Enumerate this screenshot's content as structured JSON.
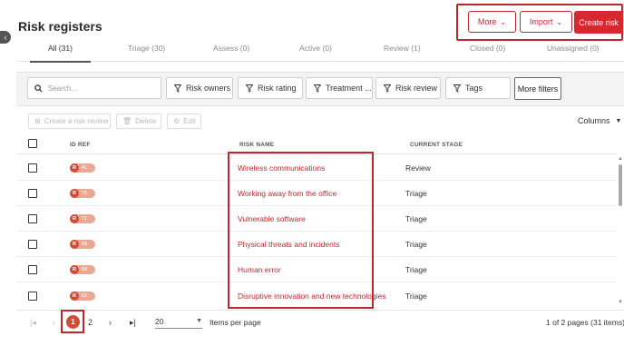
{
  "page": {
    "title": "Risk registers",
    "header_buttons": {
      "more": "More",
      "import": "Import",
      "create": "Create risk"
    },
    "tabs": [
      {
        "label": "All (31)",
        "active": true
      },
      {
        "label": "Triage (30)",
        "active": false
      },
      {
        "label": "Assess (0)",
        "active": false
      },
      {
        "label": "Active (0)",
        "active": false
      },
      {
        "label": "Review (1)",
        "active": false
      },
      {
        "label": "Closed (0)",
        "active": false
      },
      {
        "label": "Unassigned (0)",
        "active": false
      }
    ],
    "search": {
      "placeholder": "Search..."
    },
    "filters": [
      "Risk owners",
      "Risk rating",
      "Treatment ...",
      "Risk review",
      "Tags"
    ],
    "more_filters": "More filters",
    "actions": {
      "create_review": "Create a risk review",
      "delete": "Delete",
      "edit": "Edit",
      "columns": "Columns"
    },
    "table": {
      "headers": {
        "id_ref": "ID REF",
        "risk_name": "RISK NAME",
        "current_stage": "CURRENT STAGE"
      },
      "rows": [
        {
          "badge": "R",
          "id": "41",
          "name": "Wireless communications",
          "stage": "Review"
        },
        {
          "badge": "R",
          "id": "70",
          "name": "Working away from the office",
          "stage": "Triage"
        },
        {
          "badge": "R",
          "id": "71",
          "name": "Vulnerable software",
          "stage": "Triage"
        },
        {
          "badge": "R",
          "id": "69",
          "name": "Physical threats and incidents",
          "stage": "Triage"
        },
        {
          "badge": "R",
          "id": "68",
          "name": "Human error",
          "stage": "Triage"
        },
        {
          "badge": "R",
          "id": "63",
          "name": "Disruptive innovation and new technologies",
          "stage": "Triage"
        }
      ]
    },
    "pagination": {
      "current_page": "1",
      "next_page": "2",
      "per_page": "20",
      "per_page_label": "Items per page",
      "summary": "1 of 2 pages (31 items)"
    },
    "colors": {
      "accent": "#d7282f",
      "badge": "#d04d38"
    }
  }
}
